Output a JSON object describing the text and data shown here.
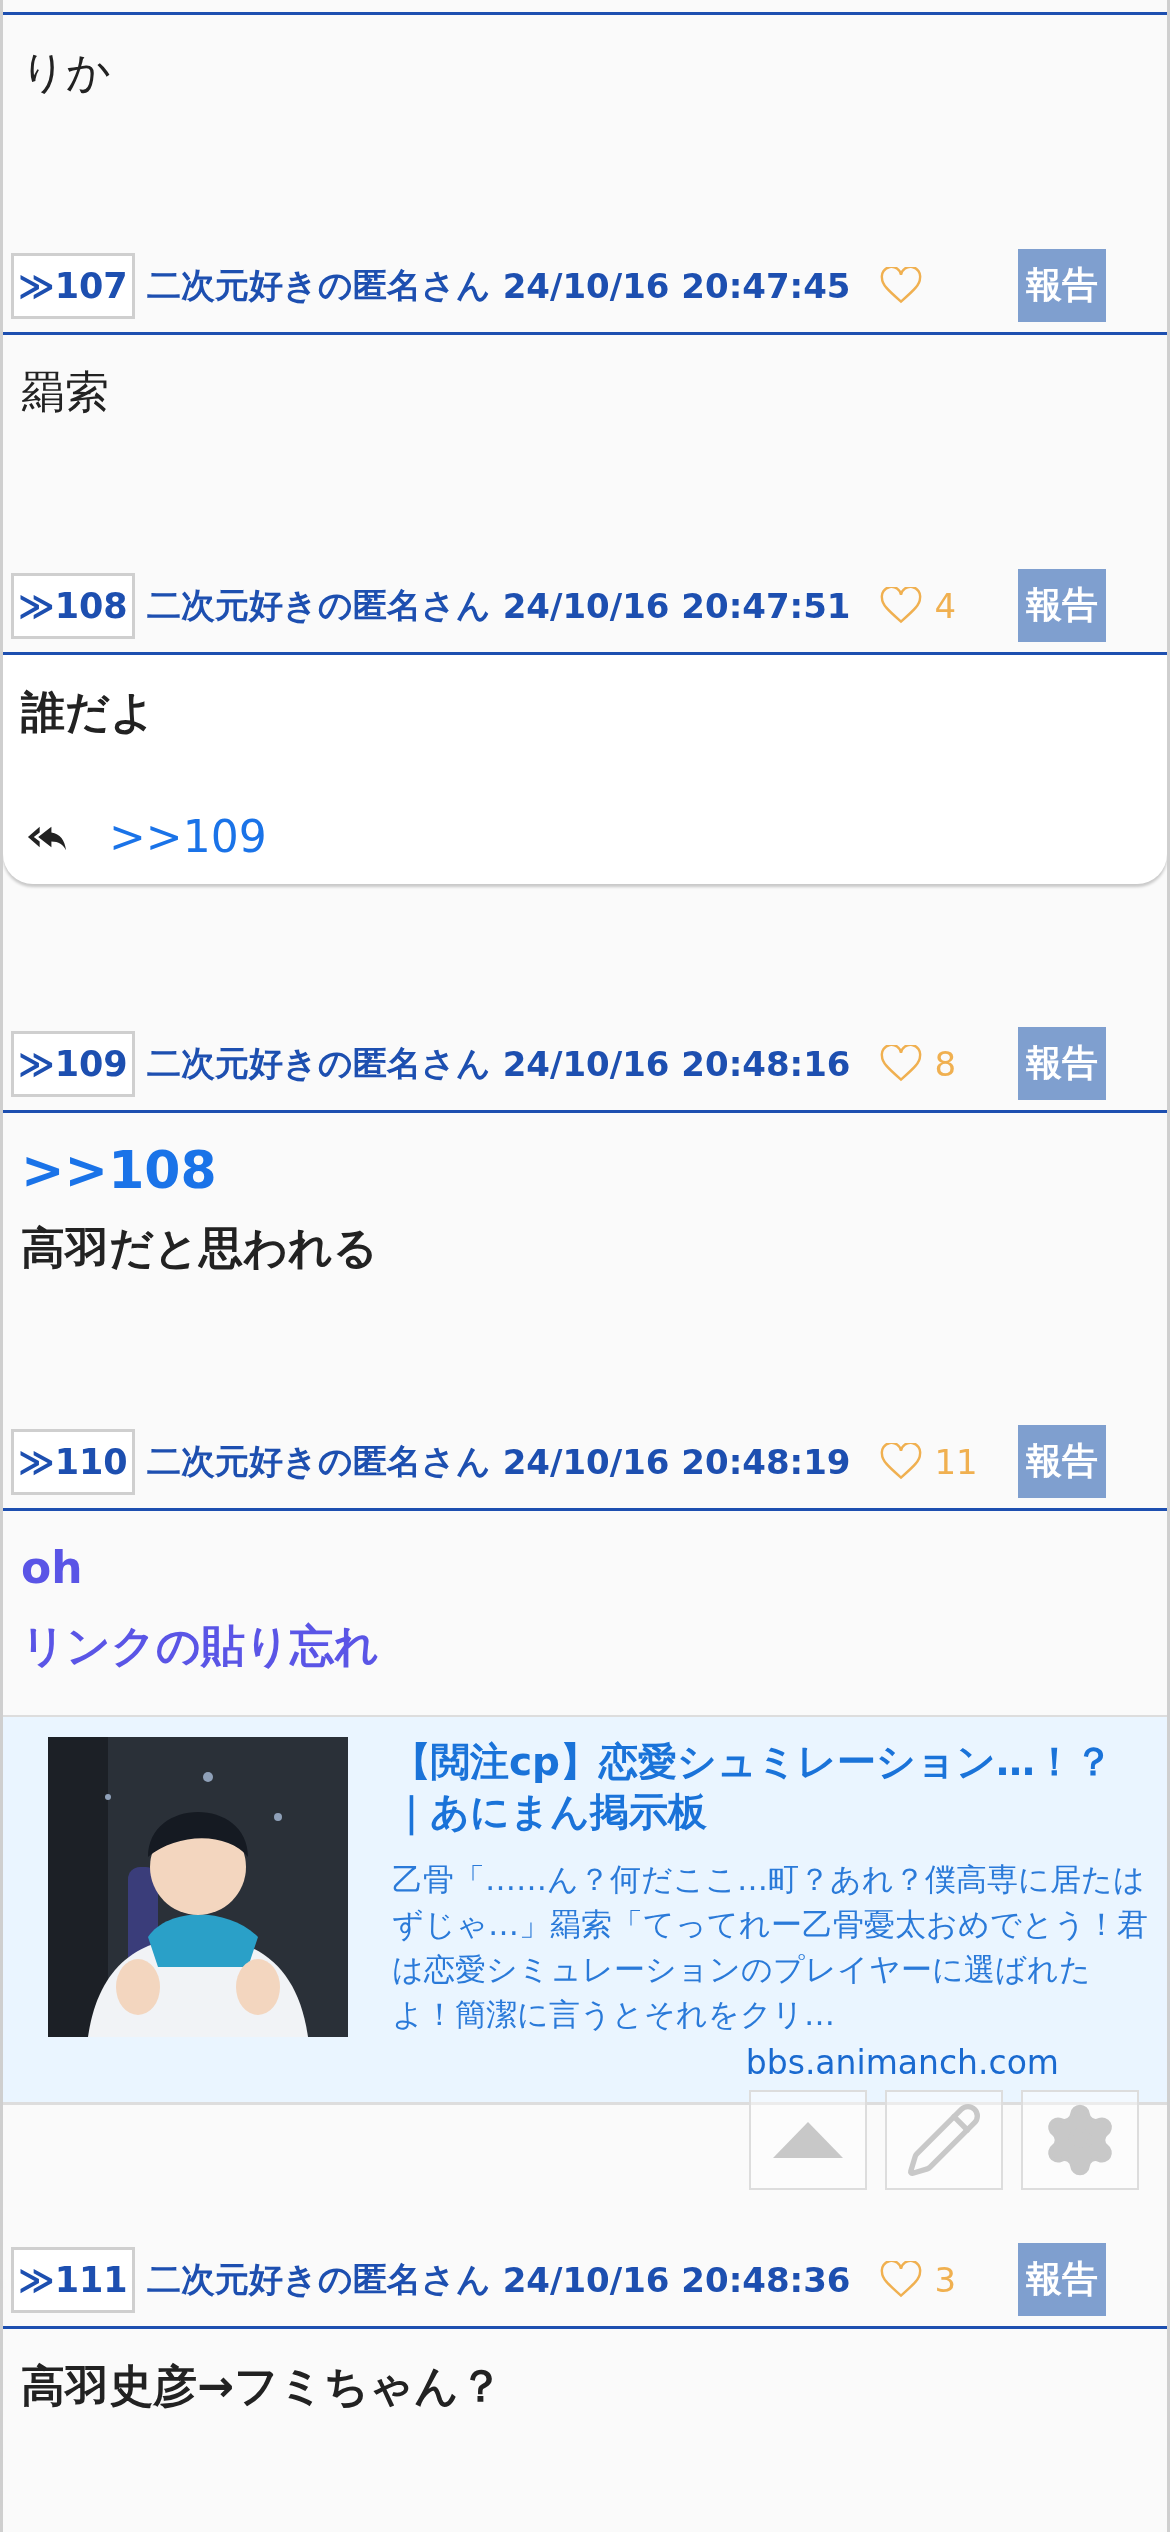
{
  "top_body": {
    "lines": [
      {
        "kind": "text",
        "text": "りか",
        "bold": false
      }
    ]
  },
  "posts": [
    {
      "number": "≫107",
      "name": "二次元好きの匿名さん",
      "date": "24/10/16 20:47:45",
      "report": "報告",
      "body": {
        "highlighted": false,
        "lines": [
          {
            "kind": "text",
            "text": "羂索",
            "bold": false
          }
        ]
      }
    },
    {
      "number": "≫108",
      "name": "二次元好きの匿名さん",
      "date": "24/10/16 20:47:51",
      "likes": "4",
      "report": "報告",
      "body": {
        "highlighted": true,
        "lines": [
          {
            "kind": "text",
            "text": "誰だよ",
            "bold": true
          }
        ],
        "reply": ">>109"
      }
    },
    {
      "number": "≫109",
      "name": "二次元好きの匿名さん",
      "date": "24/10/16 20:48:16",
      "likes": "8",
      "report": "報告",
      "body": {
        "highlighted": false,
        "lines": [
          {
            "kind": "anchor",
            "text": ">>108",
            "bold": true
          },
          {
            "kind": "text",
            "text": "高羽だと思われる",
            "bold": true
          }
        ]
      }
    },
    {
      "number": "≫110",
      "name": "二次元好きの匿名さん",
      "date": "24/10/16 20:48:19",
      "likes": "11",
      "report": "報告",
      "body": {
        "highlighted": false,
        "lines": [
          {
            "kind": "link",
            "text": "oh",
            "bold": true
          },
          {
            "kind": "link",
            "text": "リンクの貼り忘れ",
            "bold": true
          }
        ],
        "link_card": {
          "title": "【閲注cp】恋愛シュミレーション…！？｜あにまん掲示板",
          "description": "乙骨「……ん？何だここ…町？あれ？僕高専に居たはずじゃ…」羂索「てってれー乙骨憂太おめでとう！君は恋愛シミュレーションのプレイヤーに選ばれたよ！簡潔に言うとそれをクリ…",
          "domain": "bbs.animanch.com"
        }
      }
    },
    {
      "number": "≫111",
      "name": "二次元好きの匿名さん",
      "date": "24/10/16 20:48:36",
      "likes": "3",
      "report": "報告",
      "body": {
        "highlighted": false,
        "lines": [
          {
            "kind": "text",
            "text": "高羽史彦→フミちゃん？",
            "bold": true
          }
        ]
      }
    }
  ],
  "floating_buttons": [
    {
      "kind": "up"
    },
    {
      "kind": "edit"
    },
    {
      "kind": "settings"
    }
  ]
}
